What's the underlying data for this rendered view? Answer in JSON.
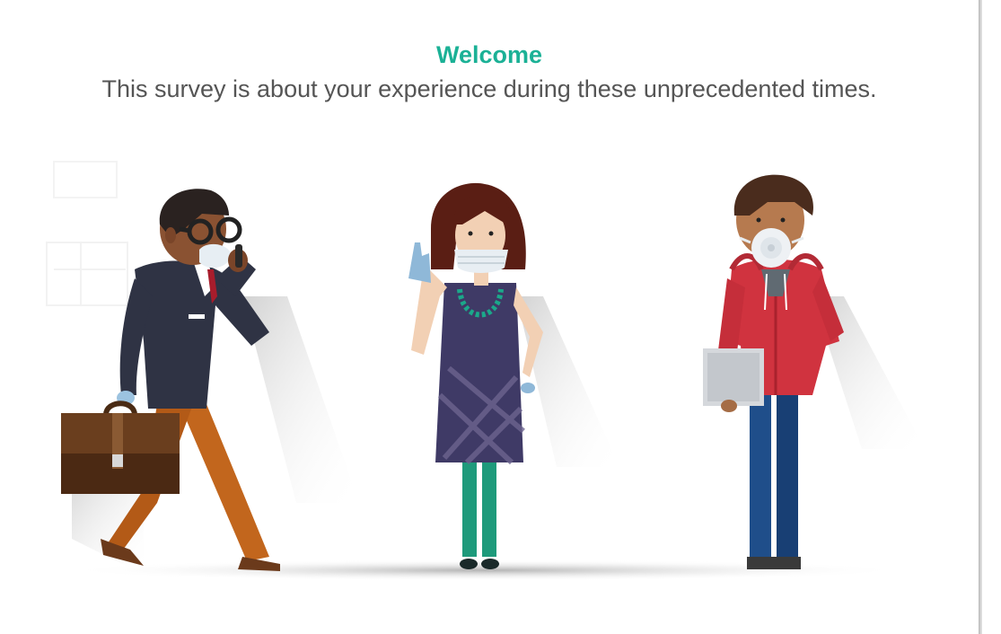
{
  "welcome": {
    "title": "Welcome",
    "subtitle": "This survey is about your experience during these unprecedented times."
  },
  "illustration": {
    "figures": [
      {
        "name": "man-with-briefcase-on-phone",
        "wearing_mask": true
      },
      {
        "name": "woman-waving",
        "wearing_mask": true
      },
      {
        "name": "man-in-red-hoodie-with-tablet",
        "wearing_mask": true
      }
    ]
  },
  "colors": {
    "accent": "#1bb196",
    "text": "#555555",
    "background": "#ffffff"
  }
}
